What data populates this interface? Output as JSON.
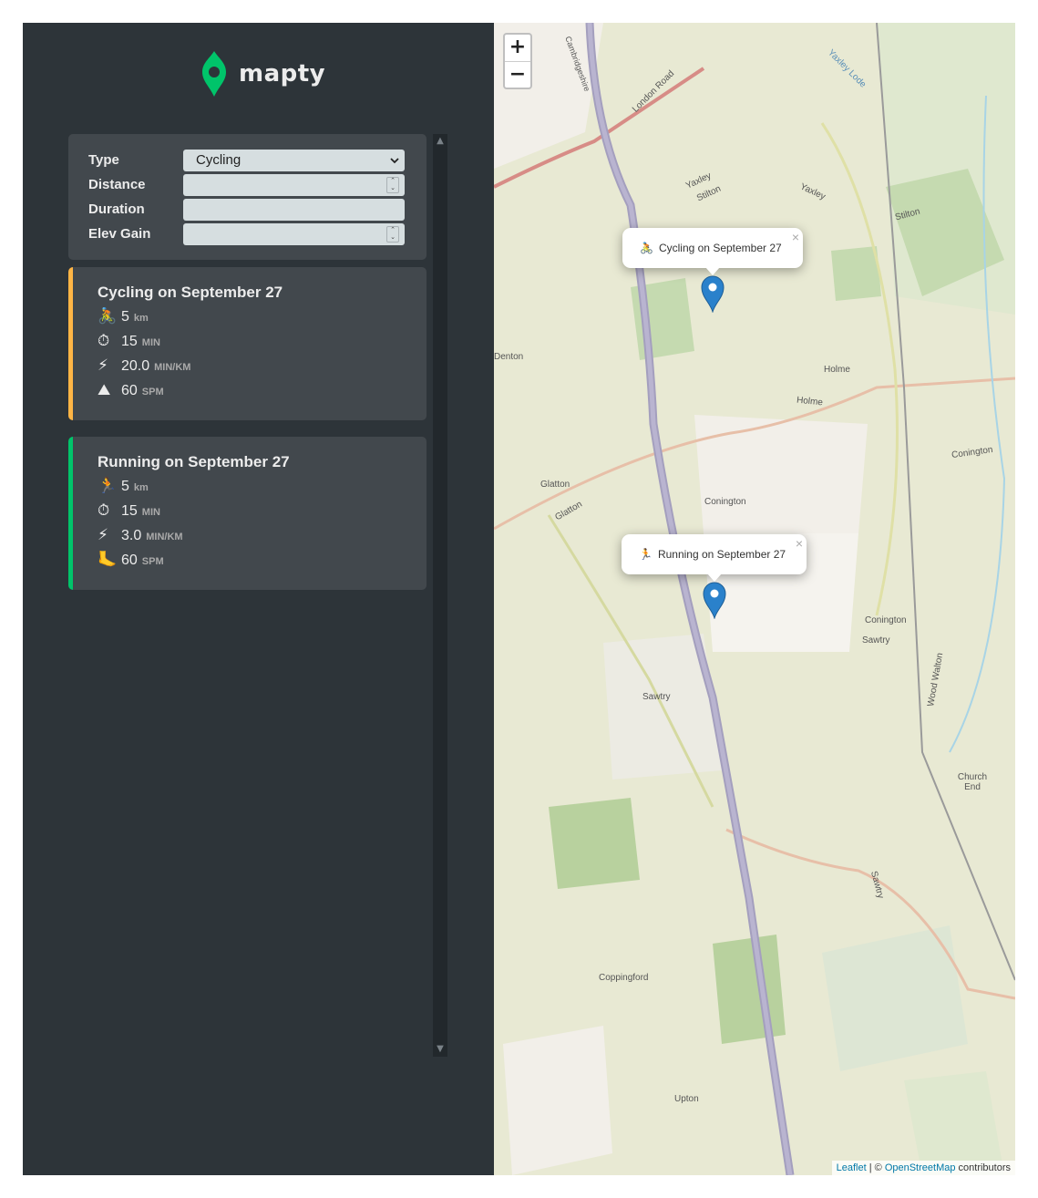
{
  "app": {
    "name": "mapty"
  },
  "form": {
    "type_label": "Type",
    "type_value": "Cycling",
    "distance_label": "Distance",
    "duration_label": "Duration",
    "elev_label": "Elev Gain"
  },
  "workouts": [
    {
      "title": "Cycling on September 27",
      "accent": "#ffb545",
      "distance_icon": "🚴",
      "distance": "5",
      "distance_unit": "km",
      "duration_icon": "⏱",
      "duration": "15",
      "duration_unit": "MIN",
      "speed_icon": "⚡",
      "speed": "20.0",
      "speed_unit": "MIN/KM",
      "extra_icon": "⛰",
      "extra": "60",
      "extra_unit": "SPM"
    },
    {
      "title": "Running on September 27",
      "accent": "#00c46a",
      "distance_icon": "🏃",
      "distance": "5",
      "distance_unit": "km",
      "duration_icon": "⏱",
      "duration": "15",
      "duration_unit": "MIN",
      "speed_icon": "⚡",
      "speed": "3.0",
      "speed_unit": "MIN/KM",
      "extra_icon": "🦶",
      "extra": "60",
      "extra_unit": "SPM"
    }
  ],
  "map": {
    "zoom_in": "+",
    "zoom_out": "−",
    "popups": [
      {
        "emoji": "🚴",
        "text": "Cycling on September 27",
        "close": "×"
      },
      {
        "emoji": "🏃",
        "text": "Running on September 27",
        "close": "×"
      }
    ],
    "labels": [
      "Yaxley",
      "Stilton",
      "Yaxley",
      "Stilton",
      "Holme",
      "Holme",
      "Denton",
      "Glatton",
      "Glatton",
      "Conington",
      "Conington",
      "Conington",
      "Sawtry",
      "Sawtry",
      "Sawtry",
      "Church End",
      "Coppingford",
      "Upton",
      "Wood Walton",
      "London Road",
      "Yaxley Lode",
      "Cambridgeshire"
    ],
    "attribution": {
      "leaflet": "Leaflet",
      "sep": " | © ",
      "osm": "OpenStreetMap",
      "contributors": " contributors"
    }
  }
}
